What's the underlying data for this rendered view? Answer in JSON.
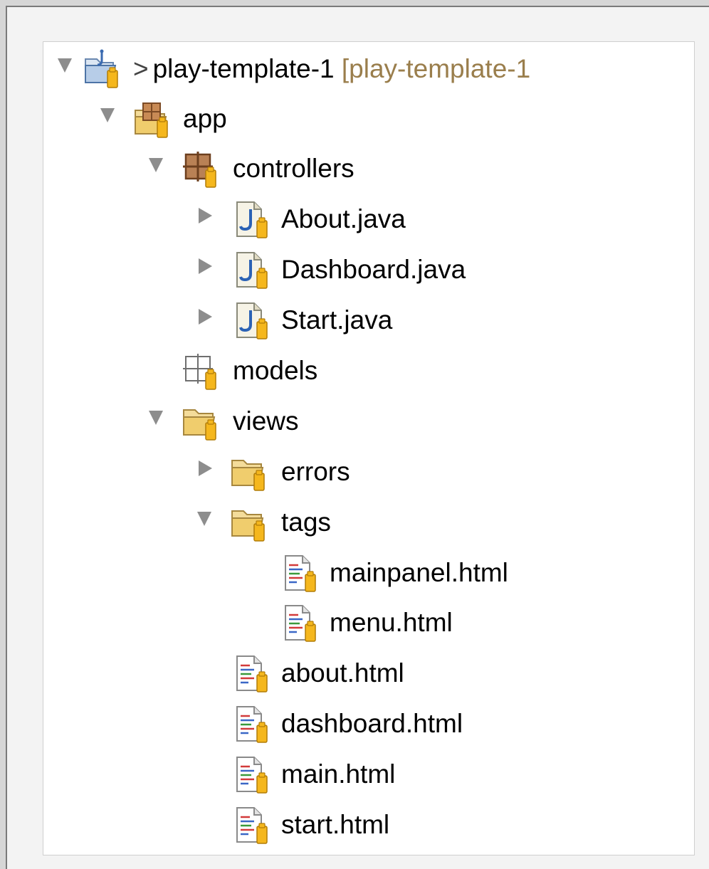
{
  "project": {
    "prefix": ">",
    "name": "play-template-1",
    "decoration": "[play-template-1"
  },
  "tree": {
    "app": "app",
    "controllers": "controllers",
    "about_java": "About.java",
    "dashboard_java": "Dashboard.java",
    "start_java": "Start.java",
    "models": "models",
    "views": "views",
    "errors": "errors",
    "tags": "tags",
    "mainpanel_html": "mainpanel.html",
    "menu_html": "menu.html",
    "about_html": "about.html",
    "dashboard_html": "dashboard.html",
    "main_html": "main.html",
    "start_html": "start.html"
  },
  "icons": {
    "project": "java-project-icon",
    "source_folder": "source-folder-icon",
    "package": "package-icon",
    "empty_package": "empty-package-icon",
    "java_file": "java-file-icon",
    "folder": "folder-icon",
    "html_file": "html-file-icon",
    "expanded": "disclosure-expanded-icon",
    "collapsed": "disclosure-collapsed-icon"
  },
  "colors": {
    "folder": "#e8c66f",
    "repo_badge": "#f2b21c",
    "package": "#a9744a",
    "java_accent": "#2b62b5"
  }
}
